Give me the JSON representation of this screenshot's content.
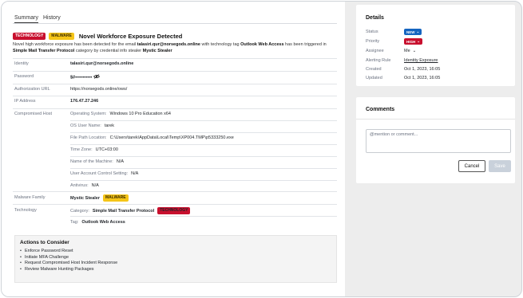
{
  "tabs": [
    {
      "label": "Summary"
    },
    {
      "label": "History"
    }
  ],
  "alert": {
    "badges": {
      "technology": "TECHNOLOGY",
      "malware": "MALWARE"
    },
    "title": "Novel Workforce Exposure Detected",
    "desc_1": "Novel high workforce exposure has been detected for the email ",
    "desc_email": "talasiri.qur@norsegods.online",
    "desc_2": " with technology tag ",
    "desc_tag": "Outlook Web Access",
    "desc_3": " has been triggered in ",
    "desc_category": "Simple Mail Transfer Protocol",
    "desc_4": " category by credential info stealer ",
    "desc_stealer": "Mystic Stealer"
  },
  "fields": {
    "identity": {
      "label": "Identity",
      "value": "talasiri.qur@norsegods.online"
    },
    "password": {
      "label": "Password",
      "value": "$#•••••••••••"
    },
    "auth_url": {
      "label": "Authorization URL",
      "value": "https://norsegods.online/ows/"
    },
    "ip": {
      "label": "IP Address",
      "value": "176.47.27.246"
    },
    "host": {
      "label": "Compromised Host",
      "os": {
        "label": "Operating System:",
        "value": "Windows 10 Pro Education x64"
      },
      "user": {
        "label": "OS User Name:",
        "value": "tarek"
      },
      "path": {
        "label": "File Path Location:",
        "value": "C:\\Users\\tarek\\AppData\\Local\\Temp\\XP004.TMP\\p5333250.exe"
      },
      "tz": {
        "label": "Time Zone:",
        "value": "UTC+03:00"
      },
      "machine": {
        "label": "Name of the Machine:",
        "value": "N/A"
      },
      "uac": {
        "label": "User Account Control Setting:",
        "value": "N/A"
      },
      "av": {
        "label": "Antivirus:",
        "value": "N/A"
      }
    },
    "malware": {
      "label": "Malware Family",
      "value": "Mystic Stealer",
      "badge": "MALWARE"
    },
    "technology": {
      "label": "Technology",
      "category_label": "Category:",
      "category_value": "Simple Mail Transfer Protocol",
      "category_badge": "TECHNOLOGY",
      "tag_label": "Tag:",
      "tag_value": "Outlook Web Access"
    }
  },
  "actions": {
    "title": "Actions to Consider",
    "items": [
      "Enforce Password Reset",
      "Initiate MFA Challenge",
      "Request Compromised Host Incident Response",
      "Review Malware Hunting Packages"
    ]
  },
  "details": {
    "title": "Details",
    "status": {
      "label": "Status",
      "value": "NEW"
    },
    "priority": {
      "label": "Priority",
      "value": "HIGH"
    },
    "assignee": {
      "label": "Assignee",
      "value": "Me"
    },
    "rule": {
      "label": "Alerting Rule",
      "value": "Identity Exposure"
    },
    "created": {
      "label": "Created",
      "value": "Oct 1, 2023, 16:05"
    },
    "updated": {
      "label": "Updated",
      "value": "Oct 1, 2023, 16:05"
    }
  },
  "comments": {
    "title": "Comments",
    "placeholder": "@mention or comment...",
    "cancel": "Cancel",
    "save": "Save"
  },
  "colors": {
    "technology_badge": "#c8102e",
    "malware_badge": "#f5c518",
    "status_new": "#1565c0",
    "priority_high": "#c8102e"
  }
}
